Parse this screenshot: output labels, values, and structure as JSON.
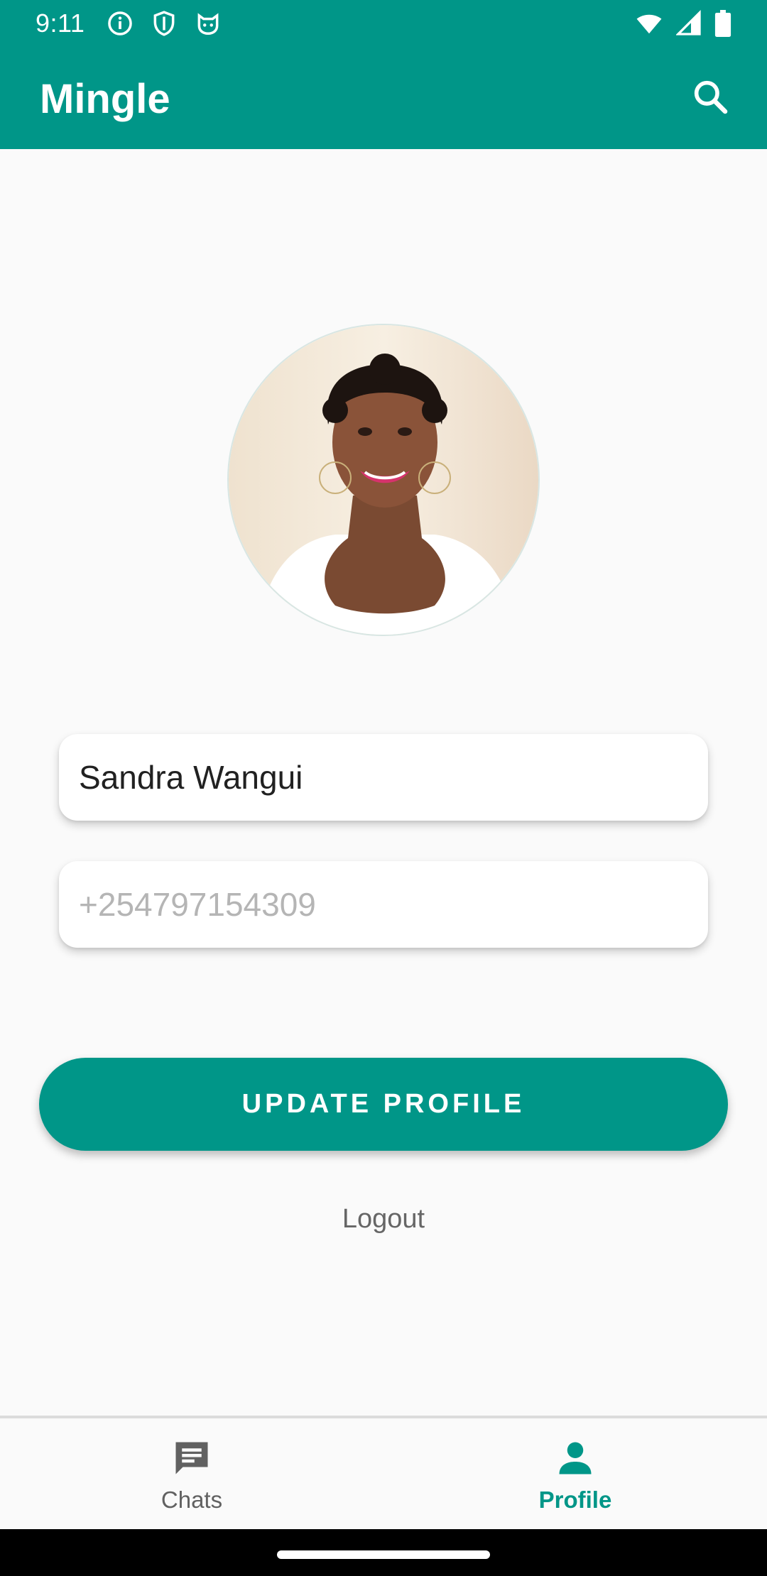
{
  "status_bar": {
    "time": "9:11",
    "icons": [
      "info-icon",
      "shield-icon",
      "cat-face-icon"
    ],
    "right_icons": [
      "wifi-icon",
      "signal-icon",
      "battery-icon"
    ]
  },
  "app_bar": {
    "title": "Mingle",
    "search_icon": "search-icon"
  },
  "profile": {
    "avatar_alt": "profile-photo",
    "name_value": "Sandra Wangui",
    "phone_placeholder": "+254797154309",
    "update_label": "UPDATE PROFILE",
    "logout_label": "Logout"
  },
  "bottom_nav": {
    "items": [
      {
        "label": "Chats",
        "icon": "chat-icon",
        "active": false
      },
      {
        "label": "Profile",
        "icon": "person-icon",
        "active": true
      }
    ]
  },
  "colors": {
    "primary": "#009688",
    "background": "#fafafa",
    "inactive": "#616161"
  }
}
